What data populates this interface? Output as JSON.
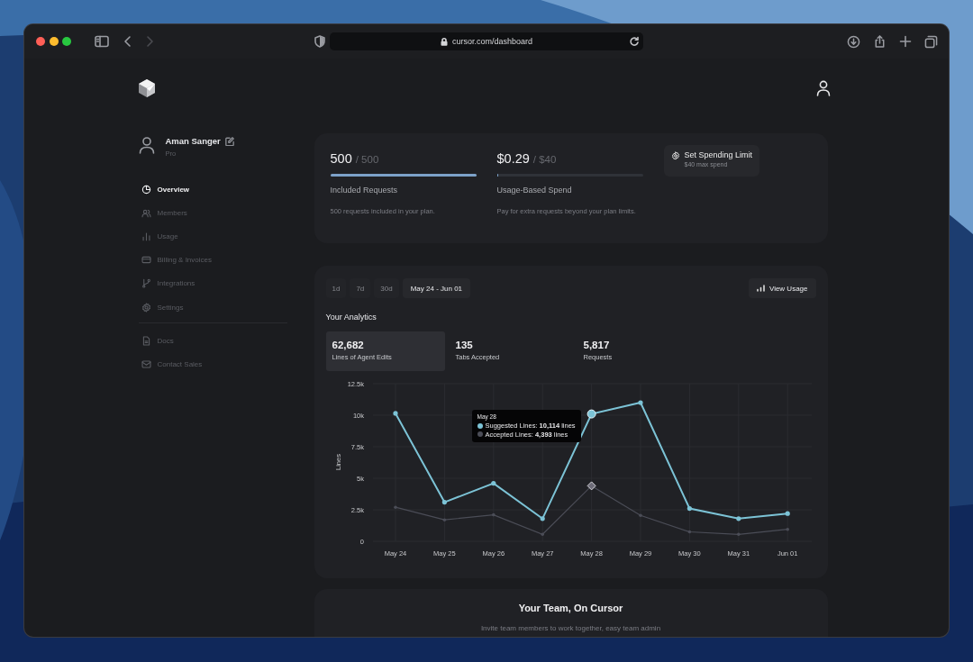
{
  "browser": {
    "url": "cursor.com/dashboard"
  },
  "user": {
    "name": "Aman Sanger",
    "plan": "Pro"
  },
  "sidebar": {
    "items": [
      {
        "label": "Overview",
        "selected": true
      },
      {
        "label": "Members",
        "selected": false
      },
      {
        "label": "Usage",
        "selected": false
      },
      {
        "label": "Billing & Invoices",
        "selected": false
      },
      {
        "label": "Integrations",
        "selected": false
      },
      {
        "label": "Settings",
        "selected": false
      }
    ],
    "footer_items": [
      {
        "label": "Docs",
        "selected": false
      },
      {
        "label": "Contact Sales",
        "selected": false
      }
    ]
  },
  "usage": {
    "meters": [
      {
        "value": "500",
        "limit": "/ 500",
        "level": 1,
        "label": "Included Requests",
        "description": "500 requests included in your plan."
      },
      {
        "value": "$0.29",
        "limit": "/ $40",
        "level": 0.007,
        "label": "Usage-Based Spend",
        "description": "Pay for extra requests beyond your plan limits."
      }
    ],
    "limit_button": {
      "label": "Set Spending Limit",
      "sublabel": "$40 max spend"
    }
  },
  "analytics": {
    "ranges": [
      {
        "label": "1d",
        "selected": false
      },
      {
        "label": "7d",
        "selected": false
      },
      {
        "label": "30d",
        "selected": false
      },
      {
        "label": "May 24 - Jun 01",
        "selected": true
      }
    ],
    "view_usage": "View Usage",
    "title": "Your Analytics",
    "stats": [
      {
        "value": "62,682",
        "label": "Lines of Agent Edits",
        "selected": true
      },
      {
        "value": "135",
        "label": "Tabs Accepted",
        "selected": false
      },
      {
        "value": "5,817",
        "label": "Requests",
        "selected": false
      }
    ],
    "chart_data": {
      "type": "line",
      "ylabel": "Lines",
      "categories": [
        "May 24",
        "May 25",
        "May 26",
        "May 27",
        "May 28",
        "May 29",
        "May 30",
        "May 31",
        "Jun 01"
      ],
      "series": [
        {
          "name": "Suggested Lines",
          "color": "#7cc3d6",
          "values": [
            10150,
            3100,
            4600,
            1800,
            10100,
            11000,
            2600,
            1800,
            2200
          ]
        },
        {
          "name": "Accepted Lines",
          "color": "#4b4d57",
          "values": [
            2700,
            1700,
            2100,
            550,
            4400,
            2050,
            750,
            550,
            950
          ]
        }
      ],
      "grid": true,
      "ylim": [
        0,
        12500
      ],
      "yticks": [
        0,
        {
          "value": 2500,
          "label": "2.5k"
        },
        {
          "value": 5000,
          "label": "5k"
        },
        {
          "value": 7500,
          "label": "7.5k"
        },
        {
          "value": 10000,
          "label": "10k"
        },
        {
          "value": 12500,
          "label": "12.5k"
        }
      ]
    },
    "tooltip": {
      "date": "May 28",
      "lines": [
        {
          "text": ": **10,114** lines"
        },
        {
          "text": ": **4,393** lines"
        }
      ]
    }
  },
  "team": {
    "title": "Your Team, On Cursor",
    "description": "Invite team members to work together, easy team admin"
  }
}
